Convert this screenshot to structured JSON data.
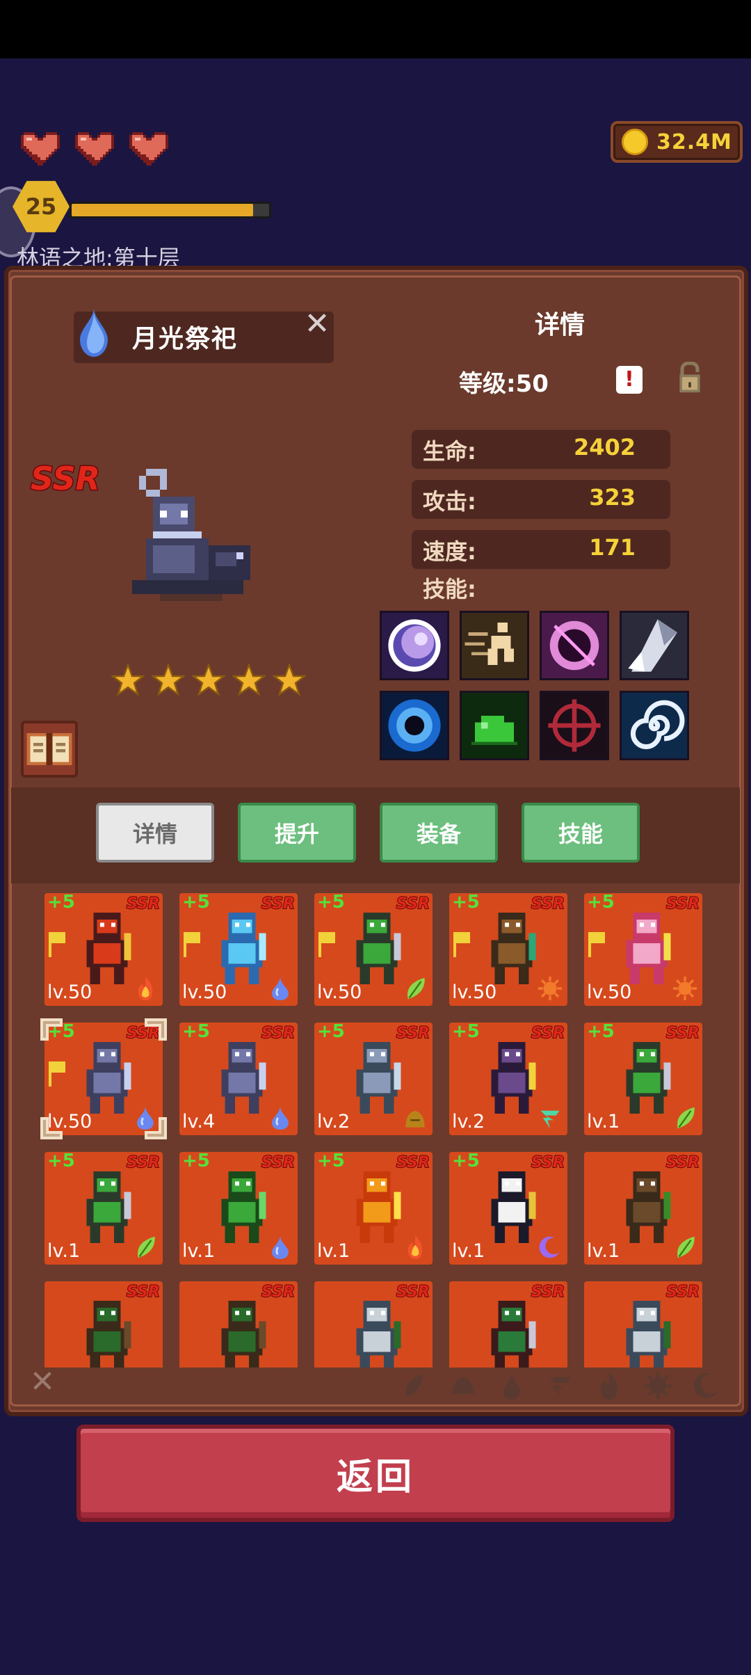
{
  "hud": {
    "lives": 3,
    "gold": "32.4M",
    "player_level": "25",
    "xp_fraction": 0.92,
    "area_name": "林语之地:第十层"
  },
  "hero": {
    "name": "月光祭祀",
    "rarity": "SSR",
    "stars": 5,
    "detail_title": "详情",
    "level_label": "等级:50",
    "stats": [
      {
        "label": "生命:",
        "value": "2402"
      },
      {
        "label": "攻击:",
        "value": "323"
      },
      {
        "label": "速度:",
        "value": "171"
      }
    ],
    "skills_label": "技能:",
    "skills": [
      "moon-orb-icon",
      "dash-icon",
      "void-ring-icon",
      "ice-shard-icon",
      "vortex-icon",
      "slime-icon",
      "crosshair-icon",
      "spiral-icon"
    ]
  },
  "tabs": [
    {
      "label": "详情",
      "active": true
    },
    {
      "label": "提升",
      "active": false
    },
    {
      "label": "装备",
      "active": false
    },
    {
      "label": "技能",
      "active": false
    }
  ],
  "roster": [
    [
      {
        "plus": "+5",
        "level": "lv.50",
        "flag": true,
        "element": "fire"
      },
      {
        "plus": "+5",
        "level": "lv.50",
        "flag": true,
        "element": "water"
      },
      {
        "plus": "+5",
        "level": "lv.50",
        "flag": true,
        "element": "leaf"
      },
      {
        "plus": "+5",
        "level": "lv.50",
        "flag": true,
        "element": "sun"
      },
      {
        "plus": "+5",
        "level": "lv.50",
        "flag": true,
        "element": "sun"
      }
    ],
    [
      {
        "plus": "+5",
        "level": "lv.50",
        "flag": true,
        "element": "water",
        "selected": true
      },
      {
        "plus": "+5",
        "level": "lv.4",
        "flag": false,
        "element": "water"
      },
      {
        "plus": "+5",
        "level": "lv.2",
        "flag": false,
        "element": "earth"
      },
      {
        "plus": "+5",
        "level": "lv.2",
        "flag": false,
        "element": "wind"
      },
      {
        "plus": "+5",
        "level": "lv.1",
        "flag": false,
        "element": "leaf"
      }
    ],
    [
      {
        "plus": "+5",
        "level": "lv.1",
        "flag": false,
        "element": "leaf"
      },
      {
        "plus": "+5",
        "level": "lv.1",
        "flag": false,
        "element": "water"
      },
      {
        "plus": "+5",
        "level": "lv.1",
        "flag": false,
        "element": "fire"
      },
      {
        "plus": "+5",
        "level": "lv.1",
        "flag": false,
        "element": "moon"
      },
      {
        "plus": "",
        "level": "lv.1",
        "flag": false,
        "element": "leaf"
      }
    ],
    [
      {
        "plus": "",
        "level": "",
        "flag": false,
        "element": ""
      },
      {
        "plus": "",
        "level": "",
        "flag": false,
        "element": ""
      },
      {
        "plus": "",
        "level": "",
        "flag": false,
        "element": ""
      },
      {
        "plus": "",
        "level": "",
        "flag": false,
        "element": ""
      },
      {
        "plus": "",
        "level": "",
        "flag": false,
        "element": ""
      }
    ]
  ],
  "filters": [
    "leaf-filter-icon",
    "earth-filter-icon",
    "water-filter-icon",
    "wind-filter-icon",
    "fire-filter-icon",
    "sun-filter-icon",
    "moon-filter-icon"
  ],
  "back_label": "返回"
}
